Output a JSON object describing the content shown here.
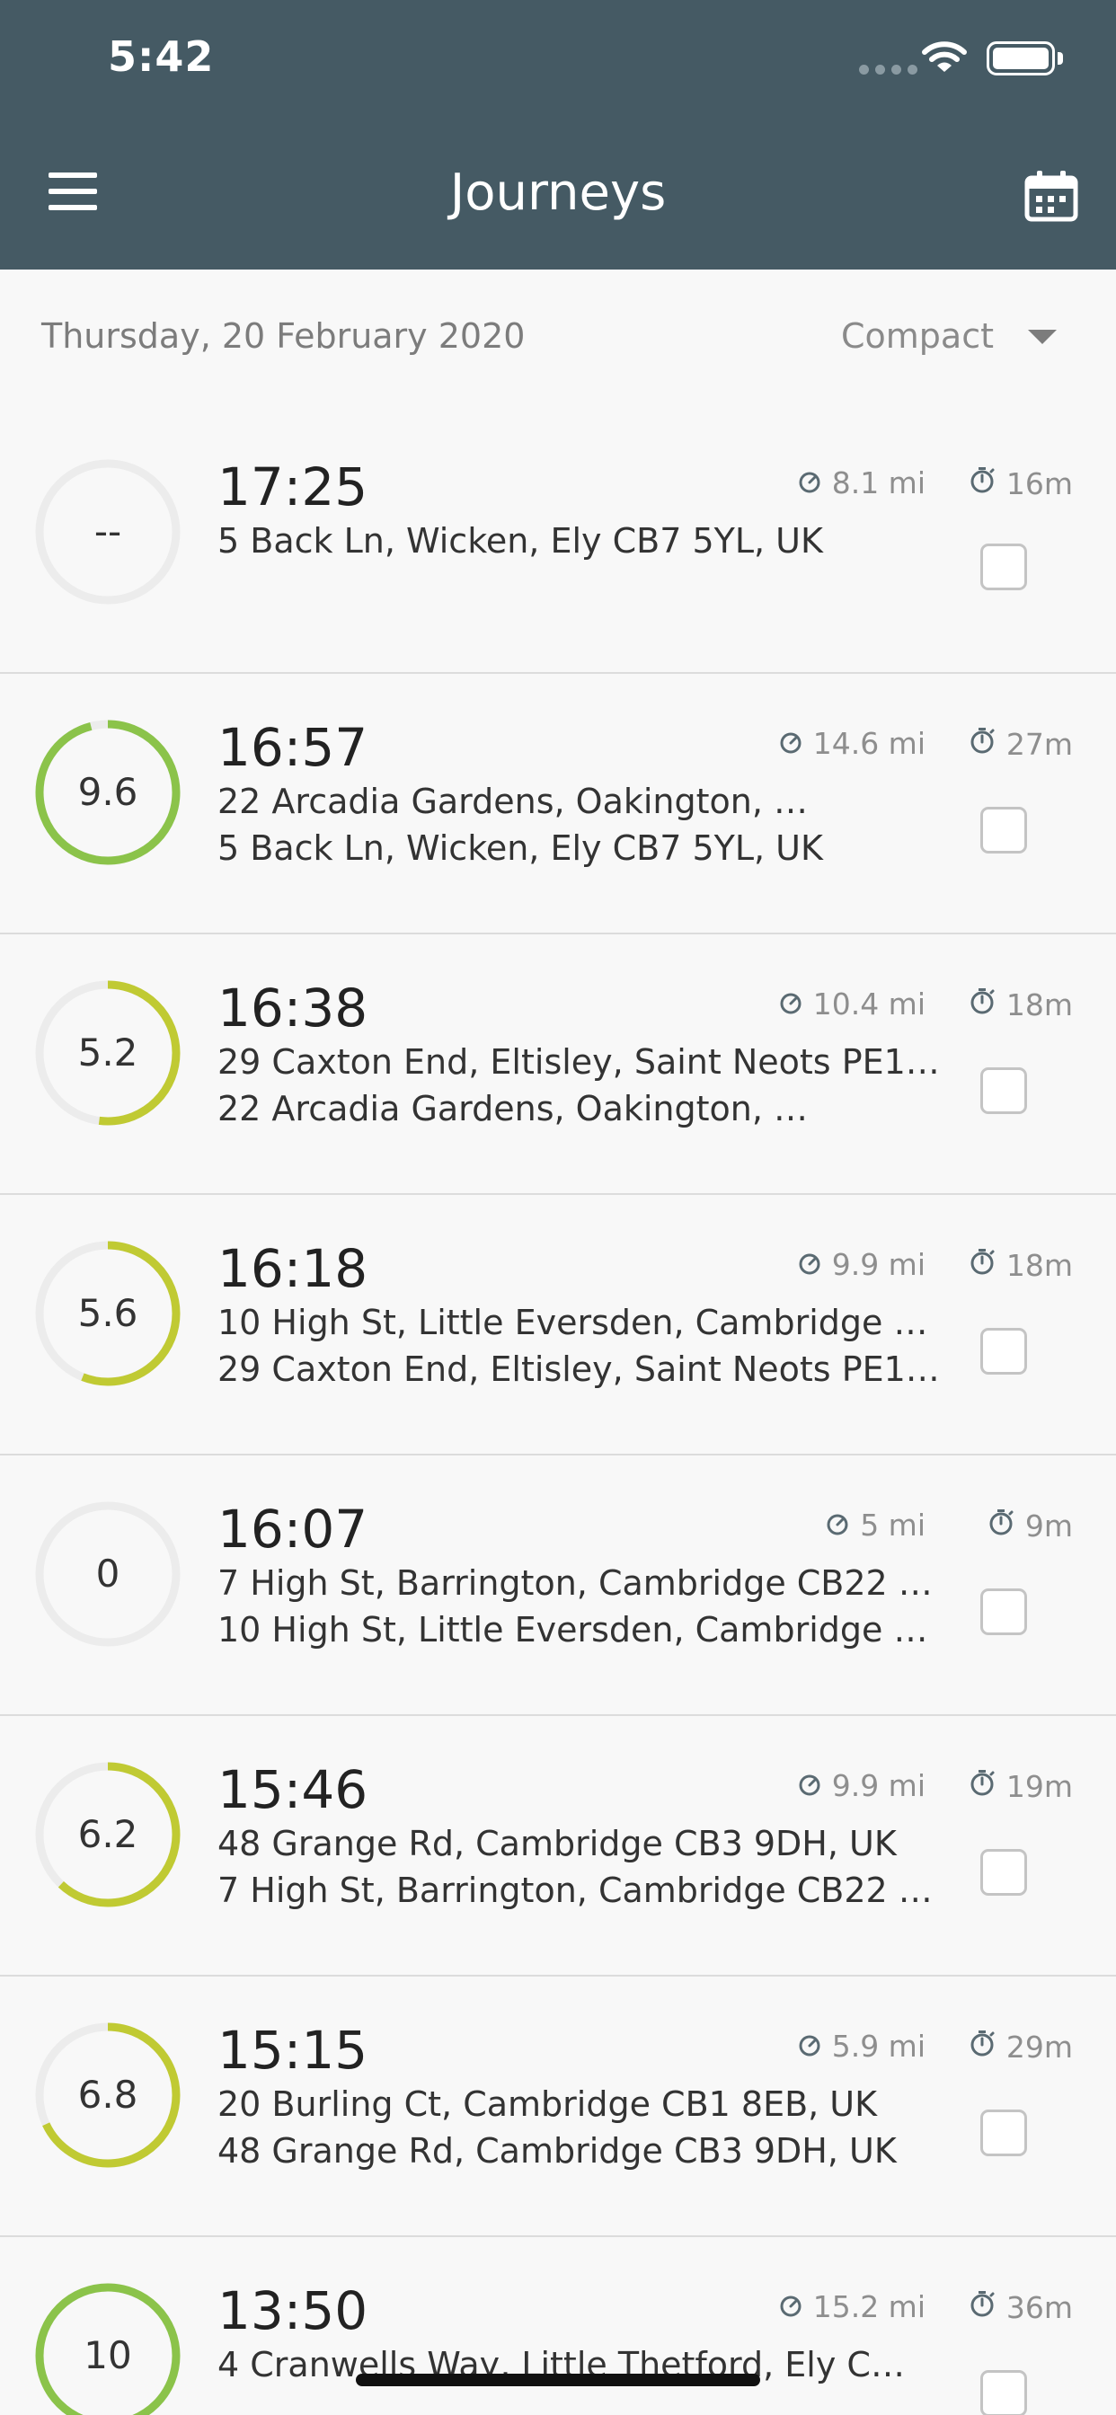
{
  "status_bar": {
    "time": "5:42"
  },
  "header": {
    "title": "Journeys",
    "menu_icon": "hamburger-menu-icon",
    "calendar_icon": "calendar-icon"
  },
  "filter": {
    "date": "Thursday, 20 February 2020",
    "view": "Compact"
  },
  "colors": {
    "header": "#455a64",
    "score_green": "#8bc34a",
    "score_yellow": "#c0ca33",
    "ring_track": "#ececec"
  },
  "journeys": [
    {
      "score": "--",
      "score_value": null,
      "color": "#c0ca33",
      "time": "17:25",
      "distance": "8.1 mi",
      "duration": "16m",
      "from": "5 Back Ln, Wicken, Ely CB7 5YL, UK",
      "to": ""
    },
    {
      "score": "9.6",
      "score_value": 9.6,
      "color": "#8bc34a",
      "time": "16:57",
      "distance": "14.6 mi",
      "duration": "27m",
      "from": "22 Arcadia Gardens, Oakington, …",
      "to": "5 Back Ln, Wicken, Ely CB7 5YL, UK"
    },
    {
      "score": "5.2",
      "score_value": 5.2,
      "color": "#c0ca33",
      "time": "16:38",
      "distance": "10.4 mi",
      "duration": "18m",
      "from": "29 Caxton End, Eltisley, Saint Neots PE1…",
      "to": "22 Arcadia Gardens, Oakington, …"
    },
    {
      "score": "5.6",
      "score_value": 5.6,
      "color": "#c0ca33",
      "time": "16:18",
      "distance": "9.9 mi",
      "duration": "18m",
      "from": "10 High St, Little Eversden, Cambridge …",
      "to": "29 Caxton End, Eltisley, Saint Neots PE1…"
    },
    {
      "score": "0",
      "score_value": 0,
      "color": "#c0ca33",
      "time": "16:07",
      "distance": "5 mi",
      "duration": "9m",
      "from": "7 High St, Barrington, Cambridge CB22 …",
      "to": "10 High St, Little Eversden, Cambridge …"
    },
    {
      "score": "6.2",
      "score_value": 6.2,
      "color": "#c0ca33",
      "time": "15:46",
      "distance": "9.9 mi",
      "duration": "19m",
      "from": "48 Grange Rd, Cambridge CB3 9DH, UK",
      "to": "7 High St, Barrington, Cambridge CB22 …"
    },
    {
      "score": "6.8",
      "score_value": 6.8,
      "color": "#c0ca33",
      "time": "15:15",
      "distance": "5.9 mi",
      "duration": "29m",
      "from": "20 Burling Ct, Cambridge CB1 8EB, UK",
      "to": "48 Grange Rd, Cambridge CB3 9DH, UK"
    },
    {
      "score": "10",
      "score_value": 10,
      "color": "#8bc34a",
      "time": "13:50",
      "distance": "15.2 mi",
      "duration": "36m",
      "from": "4 Cranwells Way, Little Thetford, Ely C…",
      "to": ""
    }
  ]
}
